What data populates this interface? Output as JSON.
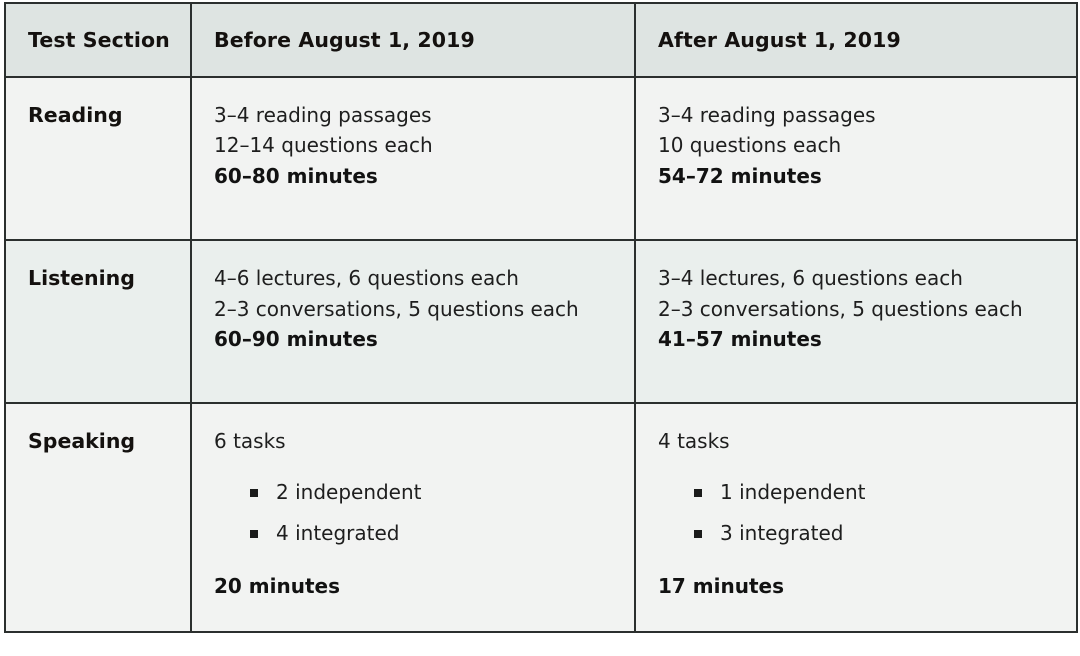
{
  "table": {
    "columns": [
      {
        "key": "section",
        "label": "Test Section"
      },
      {
        "key": "before",
        "label": "Before August 1, 2019"
      },
      {
        "key": "after",
        "label": "After August 1, 2019"
      }
    ],
    "colors": {
      "header_background": "#dee4e2",
      "row_background_a": "#f2f3f2",
      "row_background_b": "#eaefed",
      "border": "#2b2f2e",
      "text": "#1e1e1e",
      "bullet": "#1b1b1b"
    },
    "rows": [
      {
        "section": "Reading",
        "before": {
          "lines": [
            "3–4 reading passages",
            "12–14 questions each"
          ],
          "duration": "60–80 minutes",
          "bullets": []
        },
        "after": {
          "lines": [
            "3–4 reading passages",
            "10 questions each"
          ],
          "duration": "54–72 minutes",
          "bullets": []
        }
      },
      {
        "section": "Listening",
        "before": {
          "lines": [
            "4–6 lectures, 6 questions each",
            "2–3 conversations, 5 questions each"
          ],
          "duration": "60–90 minutes",
          "bullets": []
        },
        "after": {
          "lines": [
            "3–4 lectures, 6 questions each",
            "2–3 conversations, 5 questions each"
          ],
          "duration": "41–57 minutes",
          "bullets": []
        }
      },
      {
        "section": "Speaking",
        "before": {
          "lines": [
            "6 tasks"
          ],
          "bullets": [
            "2 independent",
            "4 integrated"
          ],
          "duration": "20 minutes"
        },
        "after": {
          "lines": [
            "4 tasks"
          ],
          "bullets": [
            "1 independent",
            "3 integrated"
          ],
          "duration": "17 minutes"
        }
      }
    ]
  }
}
